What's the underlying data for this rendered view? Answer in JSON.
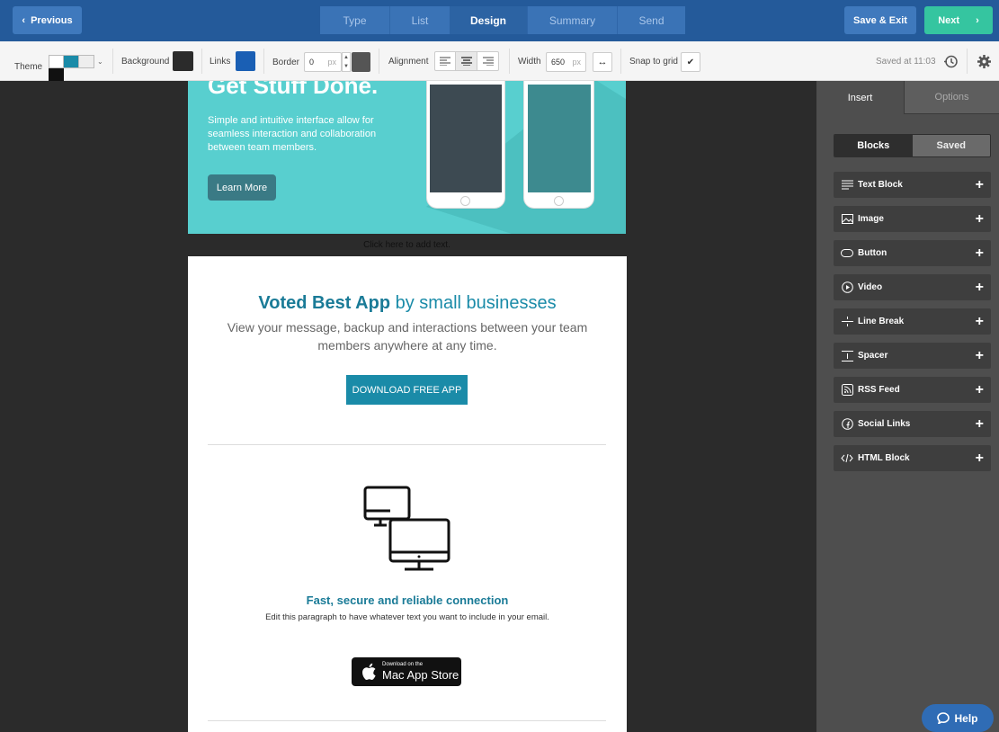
{
  "topbar": {
    "previous_label": "Previous",
    "steps": [
      "Type",
      "List",
      "Design",
      "Summary",
      "Send"
    ],
    "active_step": "Design",
    "save_exit_label": "Save & Exit",
    "next_label": "Next"
  },
  "toolbar": {
    "theme_label": "Theme",
    "background_label": "Background",
    "background_color": "#2b2b2b",
    "links_label": "Links",
    "links_color": "#1a5fb4",
    "border_label": "Border",
    "border_value": "0",
    "border_unit": "px",
    "alignment_label": "Alignment",
    "width_label": "Width",
    "width_value": "650",
    "width_unit": "px",
    "snap_label": "Snap to grid",
    "snap_checked": true,
    "saved_text": "Saved at 11:03"
  },
  "canvas": {
    "hero_title": "Get Stuff Done.",
    "hero_text": "Simple and intuitive interface allow for seamless interaction and collaboration between team members.",
    "learn_more": "Learn More",
    "add_text_hint": "Click here to add text.",
    "voted_bold": "Voted Best App",
    "voted_rest": " by small businesses",
    "voted_desc": "View your message, backup and interactions between your team members anywhere at any time.",
    "download_btn": "DOWNLOAD FREE APP",
    "feature_title": "Fast, secure and reliable connection",
    "feature_desc": "Edit this paragraph to have whatever text you want to include in your email.",
    "appstore_small": "Download on the",
    "appstore_big": "Mac App Store"
  },
  "sidebar": {
    "tabs": [
      "Insert",
      "Options"
    ],
    "segments": [
      "Blocks",
      "Saved"
    ],
    "blocks": [
      {
        "label": "Text Block",
        "icon": "text-lines-icon"
      },
      {
        "label": "Image",
        "icon": "image-icon"
      },
      {
        "label": "Button",
        "icon": "button-icon"
      },
      {
        "label": "Video",
        "icon": "play-circle-icon"
      },
      {
        "label": "Line Break",
        "icon": "line-break-icon"
      },
      {
        "label": "Spacer",
        "icon": "spacer-icon"
      },
      {
        "label": "RSS Feed",
        "icon": "rss-icon"
      },
      {
        "label": "Social Links",
        "icon": "facebook-icon"
      },
      {
        "label": "HTML Block",
        "icon": "code-icon"
      }
    ]
  },
  "help_label": "Help"
}
